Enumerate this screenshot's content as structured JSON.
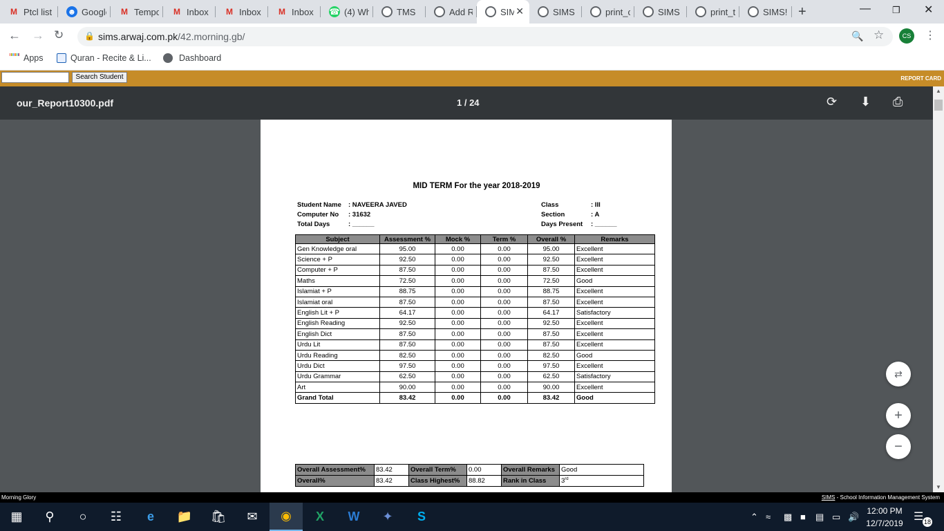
{
  "browser": {
    "tabs": [
      {
        "label": "Ptcl list",
        "icon": "gmail-icon"
      },
      {
        "label": "Google",
        "icon": "google-account-icon"
      },
      {
        "label": "Tempo",
        "icon": "gmail-icon"
      },
      {
        "label": "Inbox (",
        "icon": "gmail-icon"
      },
      {
        "label": "Inbox (",
        "icon": "gmail-icon"
      },
      {
        "label": "Inbox (",
        "icon": "gmail-icon"
      },
      {
        "label": "(4) Wh",
        "icon": "whatsapp-icon"
      },
      {
        "label": "TMS",
        "icon": "globe-icon"
      },
      {
        "label": "Add Re",
        "icon": "globe-icon"
      },
      {
        "label": "SIMS",
        "icon": "globe-icon",
        "active": true
      },
      {
        "label": "SIMS -",
        "icon": "globe-icon"
      },
      {
        "label": "print_c",
        "icon": "globe-icon"
      },
      {
        "label": "SIMS -",
        "icon": "globe-icon"
      },
      {
        "label": "print_t",
        "icon": "globe-icon"
      },
      {
        "label": "SIMS!",
        "icon": "globe-icon"
      }
    ],
    "new_tab": "+",
    "address": {
      "host": "sims.arwaj.com.pk",
      "path": "/42.morning.gb/"
    },
    "profile_initials": "CS",
    "bookmarks": [
      {
        "label": "Apps",
        "icon": "apps-grid-icon"
      },
      {
        "label": "Quran - Recite & Li...",
        "icon": "quran-icon"
      },
      {
        "label": "Dashboard",
        "icon": "globe-icon"
      }
    ]
  },
  "site": {
    "search_button": "Search Student",
    "search_value": "",
    "report_card_label": "REPORT CARD",
    "accent_color": "#c68c28"
  },
  "pdf": {
    "filename": "our_Report10300.pdf",
    "page_indicator": "1 / 24"
  },
  "report": {
    "title": "MID TERM For the year 2018-2019",
    "left_info": [
      {
        "label": "Student Name",
        "value": ": NAVEERA JAVED"
      },
      {
        "label": "Computer No",
        "value": ": 31632"
      },
      {
        "label": "Total Days",
        "value": ": ______"
      }
    ],
    "right_info": [
      {
        "label": "Class",
        "value": ": III"
      },
      {
        "label": "Section",
        "value": ": A"
      },
      {
        "label": "Days Present",
        "value": ": ______"
      }
    ],
    "columns": [
      "Subject",
      "Assessment %",
      "Mock %",
      "Term %",
      "Overall %",
      "Remarks"
    ],
    "rows": [
      [
        "Gen Knowledge oral",
        "95.00",
        "0.00",
        "0.00",
        "95.00",
        "Excellent"
      ],
      [
        "Science + P",
        "92.50",
        "0.00",
        "0.00",
        "92.50",
        "Excellent"
      ],
      [
        "Computer + P",
        "87.50",
        "0.00",
        "0.00",
        "87.50",
        "Excellent"
      ],
      [
        "Maths",
        "72.50",
        "0.00",
        "0.00",
        "72.50",
        "Good"
      ],
      [
        "Islamiat + P",
        "88.75",
        "0.00",
        "0.00",
        "88.75",
        "Excellent"
      ],
      [
        "Islamiat oral",
        "87.50",
        "0.00",
        "0.00",
        "87.50",
        "Excellent"
      ],
      [
        "English Lit + P",
        "64.17",
        "0.00",
        "0.00",
        "64.17",
        "Satisfactory"
      ],
      [
        "English Reading",
        "92.50",
        "0.00",
        "0.00",
        "92.50",
        "Excellent"
      ],
      [
        "English Dict",
        "87.50",
        "0.00",
        "0.00",
        "87.50",
        "Excellent"
      ],
      [
        "Urdu Lit",
        "87.50",
        "0.00",
        "0.00",
        "87.50",
        "Excellent"
      ],
      [
        "Urdu Reading",
        "82.50",
        "0.00",
        "0.00",
        "82.50",
        "Good"
      ],
      [
        "Urdu Dict",
        "97.50",
        "0.00",
        "0.00",
        "97.50",
        "Excellent"
      ],
      [
        "Urdu Grammar",
        "62.50",
        "0.00",
        "0.00",
        "62.50",
        "Satisfactory"
      ],
      [
        "Art",
        "90.00",
        "0.00",
        "0.00",
        "90.00",
        "Excellent"
      ]
    ],
    "total": [
      "Grand Total",
      "83.42",
      "0.00",
      "0.00",
      "83.42",
      "Good"
    ],
    "summary": [
      [
        {
          "label": "Overall Assessment%",
          "value": "83.42"
        },
        {
          "label": "Overall Term%",
          "value": "0.00"
        },
        {
          "label": "Overall Remarks",
          "value": "Good"
        }
      ],
      [
        {
          "label": "Overall%",
          "value": "83.42"
        },
        {
          "label": "Class Highest%",
          "value": "88.82"
        },
        {
          "label": "Rank in Class",
          "value": "3",
          "sup": "rd"
        }
      ]
    ]
  },
  "status": {
    "left": "Morning Glory",
    "right_link": "SIMS",
    "right_text": " - School Information Management System"
  },
  "taskbar": {
    "time": "12:00 PM",
    "date": "12/7/2019",
    "notifications": "18"
  }
}
